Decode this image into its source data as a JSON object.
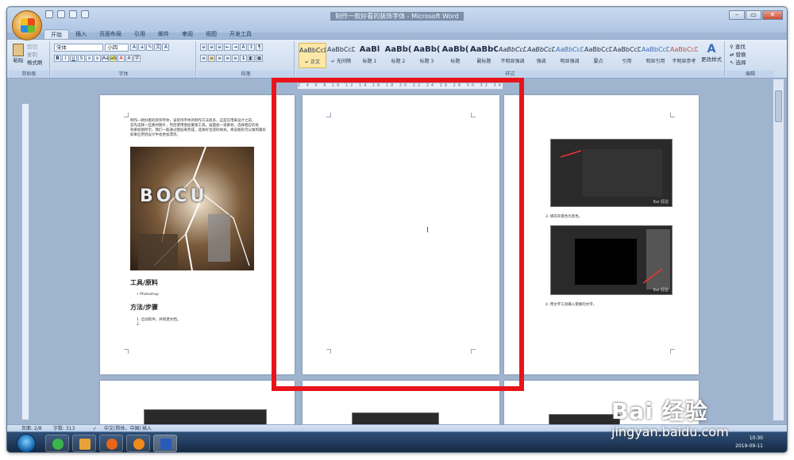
{
  "window": {
    "title": "制作一款好看的装饰字体 - Microsoft Word"
  },
  "tabs": [
    "开始",
    "插入",
    "页面布局",
    "引用",
    "邮件",
    "审阅",
    "视图",
    "开发工具"
  ],
  "clipboard": {
    "paste": "粘贴",
    "cut": "剪切",
    "copy": "复制",
    "format_painter": "格式刷",
    "title": "剪贴板"
  },
  "font": {
    "name": "宋体",
    "size": "小四",
    "title": "字体"
  },
  "paragraph": {
    "title": "段落"
  },
  "styles": {
    "title": "样式",
    "change": "更改样式",
    "items": [
      {
        "sample": "AaBbCcDd",
        "name": "↵ 正文"
      },
      {
        "sample": "AaBbCcDd",
        "name": "↵ 无间隔"
      },
      {
        "sample": "AaBl",
        "name": "标题 1"
      },
      {
        "sample": "AaBb(",
        "name": "标题 2"
      },
      {
        "sample": "AaBb(",
        "name": "标题 3"
      },
      {
        "sample": "AaBb(",
        "name": "标题"
      },
      {
        "sample": "AaBbC",
        "name": "副标题"
      },
      {
        "sample": "AaBbCcDd",
        "name": "不明显强调"
      },
      {
        "sample": "AaBbCcDd",
        "name": "强调"
      },
      {
        "sample": "AaBbCcDd",
        "name": "明显强调"
      },
      {
        "sample": "AaBbCcDd",
        "name": "要点"
      },
      {
        "sample": "AaBbCcDd",
        "name": "引用"
      },
      {
        "sample": "AaBbCcDd",
        "name": "明显引用"
      },
      {
        "sample": "AaBbCcDd",
        "name": "不明显参考"
      }
    ]
  },
  "editing": {
    "find": "查找",
    "replace": "替换",
    "select": "选择",
    "title": "编辑"
  },
  "ruler": {
    "ticks": "2 4 6 8 10 12 14 16 18 20 22 24 26 28 30 32 34 36 38 40 42"
  },
  "page1": {
    "para": [
      "制作一款好看的装饰字体，该装饰字体的制作方法很多，这是在用来设计之前，",
      "首先选择一些素材图片，然后使用图层蒙版工具。画面加一道素材，选择相应的处",
      "效果如图所示。我们一般通过图层来完成，选择好合适的样式。将该图形可以做到最好",
      "如果应用到设计中会更加漂亮。"
    ],
    "img_text": "BOCU",
    "tools_heading": "工具/原料",
    "tools_item": "Photoshop",
    "method_heading": "方法/步骤",
    "step1": "1. 启动软件，并新建文档。",
    "step2": "2."
  },
  "page3": {
    "step3": "3. 填充背景色为黑色。",
    "step4": "4. 用文字工具输入需要的文字。",
    "thumb_wm": "Bai 经验"
  },
  "status": {
    "page": "页面: 2/8",
    "words": "字数: 313",
    "lang": "中文(简体，中国)",
    "mode": "插入"
  },
  "tray": {
    "time": "10:30",
    "date": "2019-09-11"
  },
  "watermark": {
    "logo": "Bai 经验",
    "url": "jingyan.baidu.com"
  }
}
